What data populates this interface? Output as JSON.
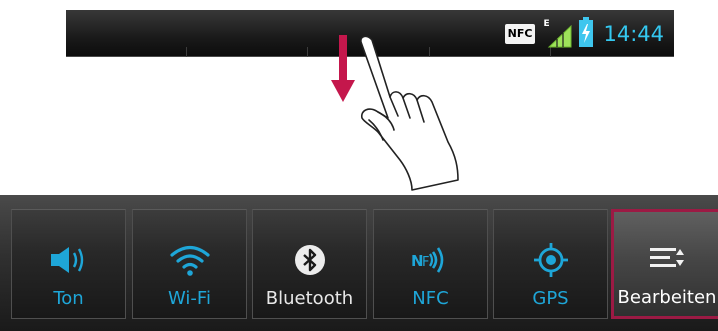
{
  "status_bar": {
    "nfc_label": "NFC",
    "network_type": "E",
    "time": "14:44",
    "icons": [
      "nfc-icon",
      "signal-icon",
      "battery-charging-icon"
    ],
    "time_color": "#34c8f0"
  },
  "gesture": {
    "icons": [
      "swipe-down-arrow-icon",
      "pointing-hand-icon"
    ],
    "arrow_color": "#c4174c"
  },
  "quick_settings": {
    "accent_color": "#1ea6d8",
    "highlight_color": "#9c1a44",
    "tiles": [
      {
        "label": "Ton",
        "icon": "speaker-icon",
        "active": true
      },
      {
        "label": "Wi-Fi",
        "icon": "wifi-icon",
        "active": true
      },
      {
        "label": "Bluetooth",
        "icon": "bluetooth-icon",
        "active": false
      },
      {
        "label": "NFC",
        "icon": "nfc-icon",
        "active": true
      },
      {
        "label": "GPS",
        "icon": "gps-icon",
        "active": true
      },
      {
        "label": "Bearbeiten",
        "icon": "edit-list-icon",
        "active": false,
        "highlighted": true
      }
    ]
  }
}
